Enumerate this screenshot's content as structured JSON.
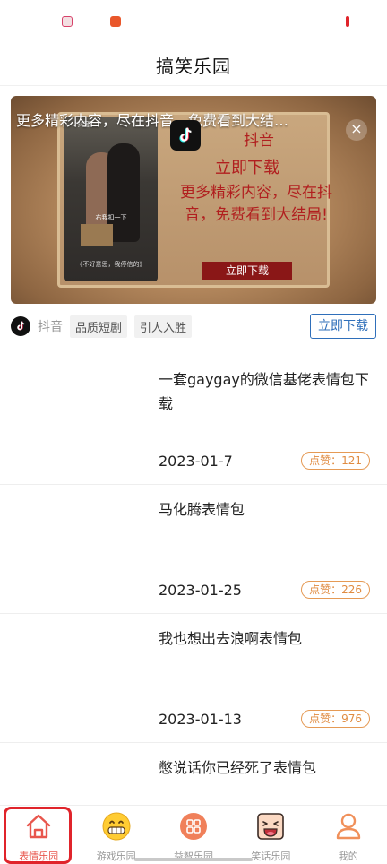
{
  "nav": {
    "title": "搞笑乐园"
  },
  "ad": {
    "headline": "更多精彩内容，尽在抖音，免费看到大结…",
    "brand": "抖音",
    "cta_big": "立即下载",
    "description": "更多精彩内容，尽在抖音，免费看到大结局!",
    "button_inner": "立即下载",
    "close_glyph": "×",
    "video_brand": "♪抖音",
    "video_hint": "右我扣一下",
    "video_caption": "《不好意思，我停信的》",
    "meta": {
      "source": "抖音",
      "tags": [
        "品质短剧",
        "引人入胜"
      ],
      "download_label": "立即下载"
    }
  },
  "posts": [
    {
      "title": "一套gaygay的微信基佬表情包下载",
      "date": "2023-01-7",
      "likes": "点赞：121"
    },
    {
      "title": "马化腾表情包",
      "date": "2023-01-25",
      "likes": "点赞：226"
    },
    {
      "title": "我也想出去浪啊表情包",
      "date": "2023-01-13",
      "likes": "点赞：976"
    },
    {
      "title": "憋说话你已经死了表情包",
      "date": "",
      "likes": ""
    }
  ],
  "tabs": [
    {
      "label": "表情乐园",
      "icon": "house-icon",
      "active": true
    },
    {
      "label": "游戏乐园",
      "icon": "grin-emoji-icon",
      "active": false
    },
    {
      "label": "益智乐园",
      "icon": "grid-apps-icon",
      "active": false
    },
    {
      "label": "笑话乐园",
      "icon": "laughing-face-icon",
      "active": false
    },
    {
      "label": "我的",
      "icon": "person-icon",
      "active": false
    }
  ],
  "colors": {
    "accent": "#e8564d",
    "ad_red": "#b11f1f",
    "link_blue": "#2f6fba",
    "likes_orange": "#e08c42"
  }
}
